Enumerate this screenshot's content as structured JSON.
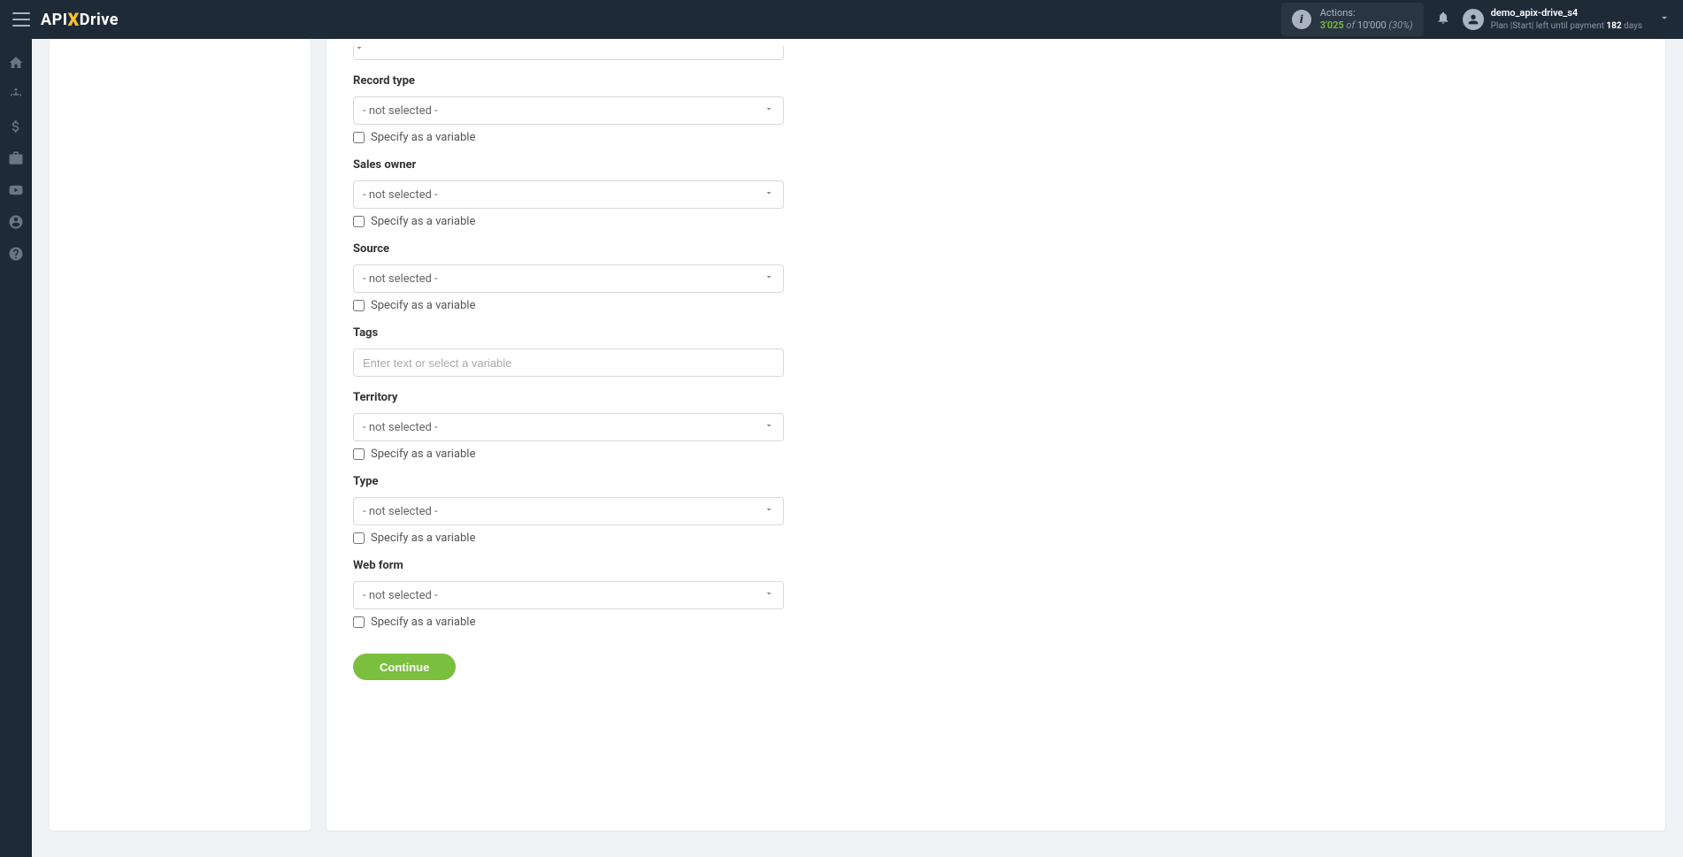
{
  "header": {
    "actions_label": "Actions:",
    "actions_current": "3'025",
    "actions_of": " of ",
    "actions_total": "10'000",
    "actions_percent": " (30%)",
    "user_name": "demo_apix-drive_s4",
    "plan_prefix": "Plan |Start| left until payment ",
    "plan_days": "182",
    "plan_suffix": " days"
  },
  "form": {
    "not_selected": "- not selected -",
    "specify_variable": "Specify as a variable",
    "tags_placeholder": "Enter text or select a variable",
    "fields": {
      "record_type": "Record type",
      "sales_owner": "Sales owner",
      "source": "Source",
      "tags": "Tags",
      "territory": "Territory",
      "type": "Type",
      "web_form": "Web form"
    },
    "continue": "Continue"
  }
}
